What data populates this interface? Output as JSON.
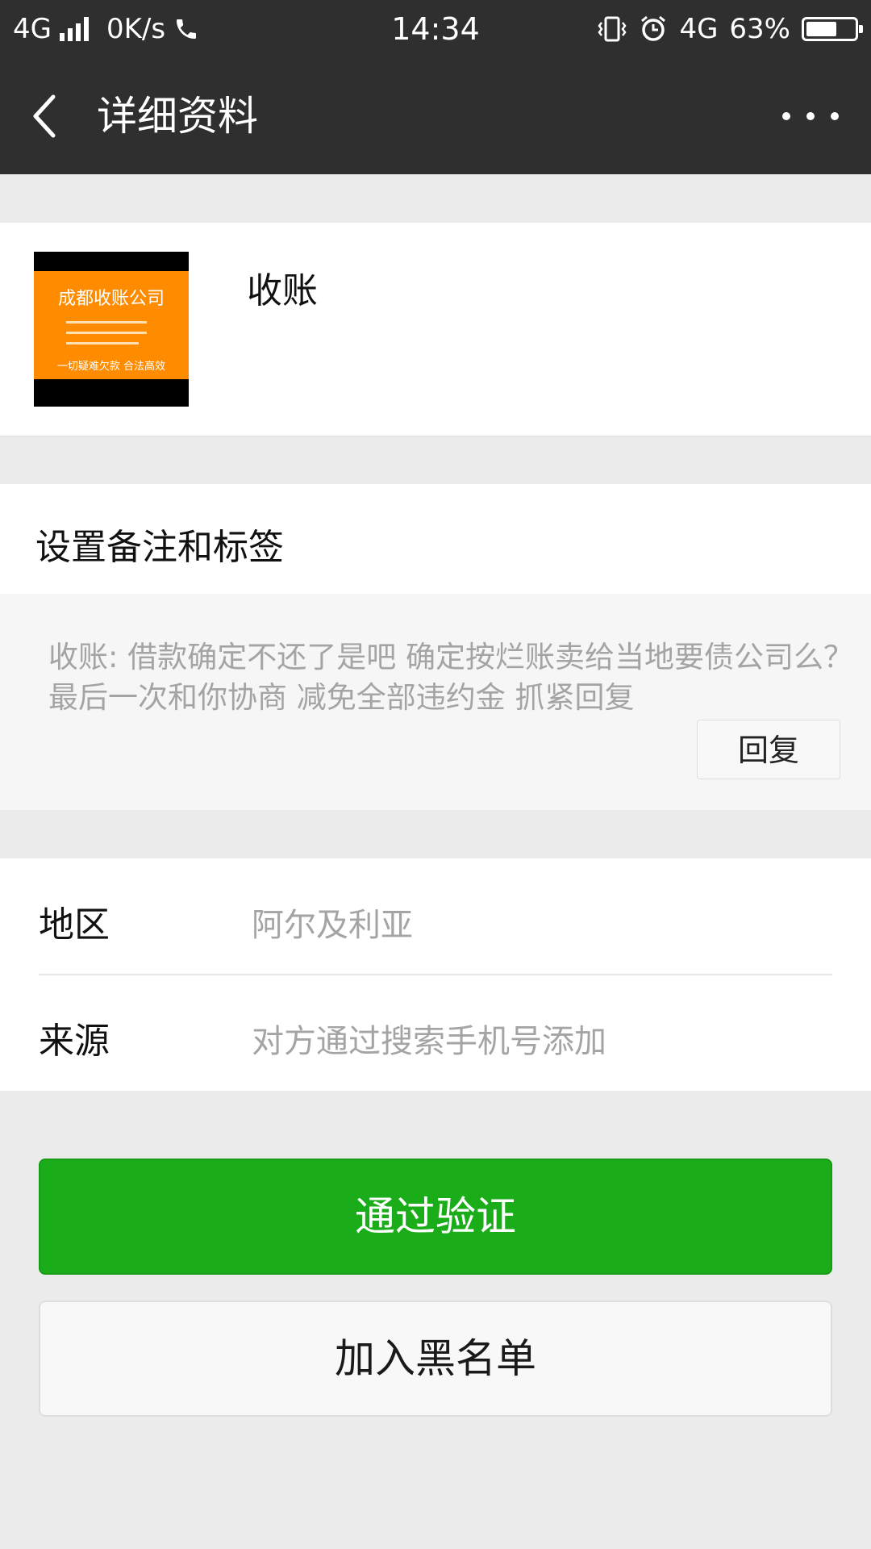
{
  "status_bar": {
    "network": "4G",
    "speed": "0K/s",
    "time": "14:34",
    "network_right": "4G",
    "battery": "63%",
    "battery_level": 0.63
  },
  "nav": {
    "title": "详细资料"
  },
  "profile": {
    "name": "收账",
    "avatar_title": "成都收账公司",
    "avatar_footer": "一切疑难欠款 合法高效"
  },
  "remark": {
    "label": "设置备注和标签",
    "message": "收账: 借款确定不还了是吧 确定按烂账卖给当地要债公司么？最后一次和你协商 减免全部违约金 抓紧回复",
    "reply_label": "回复"
  },
  "info": {
    "rows": [
      {
        "label": "地区",
        "value": "阿尔及利亚"
      },
      {
        "label": "来源",
        "value": "对方通过搜索手机号添加"
      }
    ]
  },
  "actions": {
    "verify_label": "通过验证",
    "blacklist_label": "加入黑名单"
  },
  "colors": {
    "header_bg": "#2f2f2f",
    "primary_green": "#1aad19",
    "page_bg": "#ebebeb"
  }
}
